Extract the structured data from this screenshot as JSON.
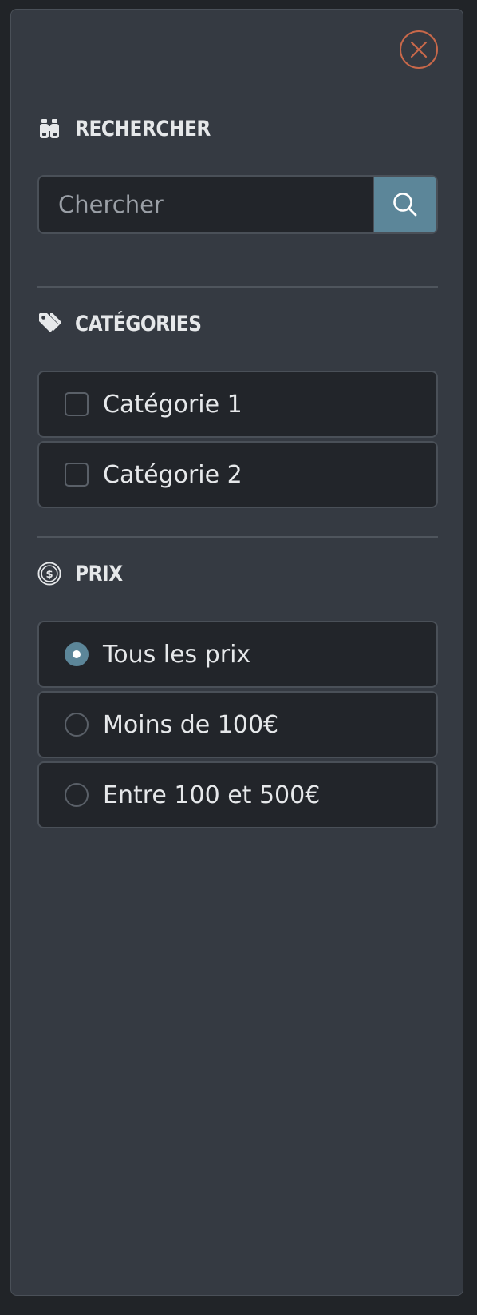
{
  "close": {
    "icon": "close-circle-icon",
    "color": "#c8684a"
  },
  "search": {
    "title": "RECHERCHER",
    "icon": "binoculars-icon",
    "placeholder": "Chercher",
    "value": "",
    "button_icon": "search-icon",
    "button_color": "#5c8699"
  },
  "categories": {
    "title": "CATÉGORIES",
    "icon": "tag-icon",
    "items": [
      {
        "label": "Catégorie 1",
        "checked": false
      },
      {
        "label": "Catégorie 2",
        "checked": false
      }
    ]
  },
  "price": {
    "title": "PRIX",
    "icon": "dollar-circle-icon",
    "options": [
      {
        "label": "Tous les prix",
        "selected": true
      },
      {
        "label": "Moins de 100€",
        "selected": false
      },
      {
        "label": "Entre 100 et 500€",
        "selected": false
      }
    ]
  }
}
